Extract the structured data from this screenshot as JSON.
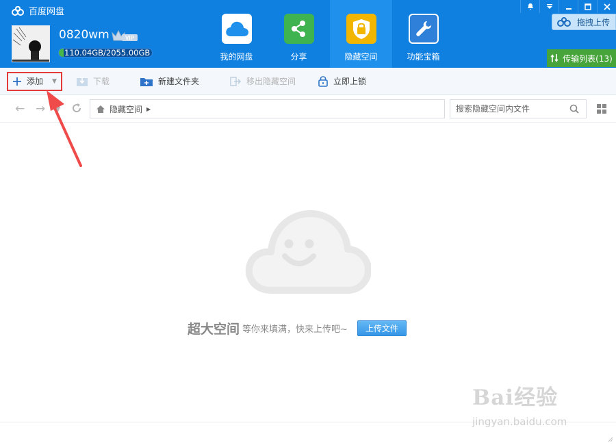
{
  "app": {
    "title": "百度网盘"
  },
  "user": {
    "name": "0820wm",
    "vip_label": "VIP",
    "storage_text": "110.04GB/2055.00GB",
    "storage_used_fraction": 0.054
  },
  "nav": {
    "items": [
      {
        "label": "我的网盘",
        "icon": "cloud-icon",
        "active": false
      },
      {
        "label": "分享",
        "icon": "share-icon",
        "active": false
      },
      {
        "label": "隐藏空间",
        "icon": "lock-shield-icon",
        "active": true
      },
      {
        "label": "功能宝箱",
        "icon": "toolbox-icon",
        "active": false
      }
    ]
  },
  "header": {
    "drag_upload_label": "拖拽上传",
    "transfer_list_label": "传输列表(13)"
  },
  "toolbar": {
    "add_label": "添加",
    "download_label": "下载",
    "new_folder_label": "新建文件夹",
    "move_out_label": "移出隐藏空间",
    "lock_label": "立即上锁"
  },
  "address": {
    "breadcrumb": "隐藏空间",
    "search_placeholder": "搜索隐藏空间内文件"
  },
  "empty_state": {
    "headline": "超大空间",
    "subtext": "等你来填满，快来上传吧~",
    "upload_button": "上传文件"
  },
  "watermark": {
    "brand": "Bai经验",
    "url": "jingyan.baidu.com"
  },
  "colors": {
    "header": "#0f7fe0",
    "active_nav": "#1f90ec",
    "transfer": "#47a43a",
    "highlight": "#e53a3a"
  }
}
